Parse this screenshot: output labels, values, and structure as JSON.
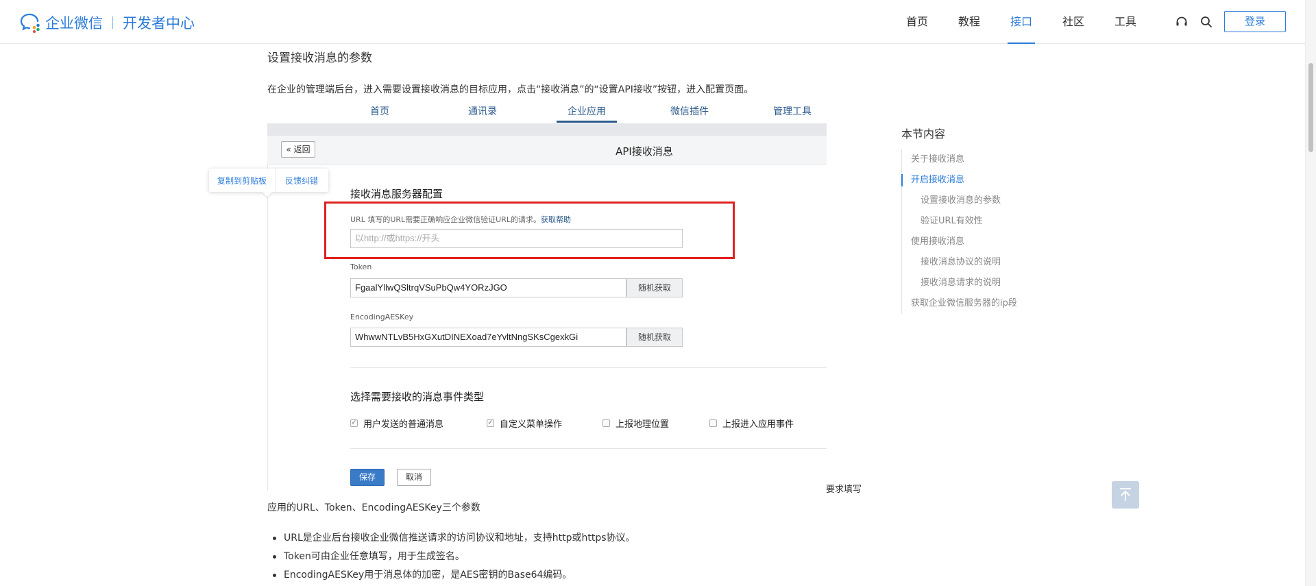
{
  "header": {
    "logo_text": "企业微信",
    "logo_sub": "开发者中心",
    "nav": [
      {
        "label": "首页",
        "active": false
      },
      {
        "label": "教程",
        "active": false
      },
      {
        "label": "接口",
        "active": true
      },
      {
        "label": "社区",
        "active": false
      },
      {
        "label": "工具",
        "active": false
      }
    ],
    "icons": [
      "headset-icon",
      "search-icon"
    ],
    "login_label": "登录"
  },
  "content": {
    "section_title": "设置接收消息的参数",
    "intro": "在企业的管理端后台，进入需要设置接收消息的目标应用，点击“接收消息”的“设置API接收”按钮，进入配置页面。",
    "popover": {
      "copy": "复制到剪贴板",
      "feedback": "反馈纠错"
    },
    "required_note": "要求填写",
    "params_line": "应用的URL、Token、EncodingAESKey三个参数",
    "bullets": [
      "URL是企业后台接收企业微信推送请求的访问协议和地址，支持http或https协议。",
      "Token可由企业任意填写，用于生成签名。",
      "EncodingAESKey用于消息体的加密，是AES密钥的Base64编码。"
    ]
  },
  "screenshot": {
    "tabs": [
      "首页",
      "通讯录",
      "企业应用",
      "微信插件",
      "管理工具"
    ],
    "active_tab": "企业应用",
    "back_label": "« 返回",
    "title": "API接收消息",
    "cfg_title": "接收消息服务器配置",
    "url_label": "URL  填写的URL需要正确响应企业微信验证URL的请求。",
    "url_help": "获取帮助",
    "url_placeholder": "以http://或https://开头",
    "token_label": "Token",
    "token_value": "FgaalYllwQSltrqVSuPbQw4YORzJGO",
    "aes_label": "EncodingAESKey",
    "aes_value": "WhwwNTLvB5HxGXutDINEXoad7eYvltNngSKsCgexkGi",
    "random_label": "随机获取",
    "events_title": "选择需要接收的消息事件类型",
    "events": [
      {
        "label": "用户发送的普通消息",
        "checked": true
      },
      {
        "label": "自定义菜单操作",
        "checked": true
      },
      {
        "label": "上报地理位置",
        "checked": false
      },
      {
        "label": "上报进入应用事件",
        "checked": false
      }
    ],
    "save_label": "保存",
    "cancel_label": "取消"
  },
  "toc": {
    "title": "本节内容",
    "items": [
      {
        "label": "关于接收消息",
        "level": 1,
        "active": false
      },
      {
        "label": "开启接收消息",
        "level": 1,
        "active": true
      },
      {
        "label": "设置接收消息的参数",
        "level": 2,
        "active": false
      },
      {
        "label": "验证URL有效性",
        "level": 2,
        "active": false
      },
      {
        "label": "使用接收消息",
        "level": 1,
        "active": false
      },
      {
        "label": "接收消息协议的说明",
        "level": 2,
        "active": false
      },
      {
        "label": "接收消息请求的说明",
        "level": 2,
        "active": false
      },
      {
        "label": "获取企业微信服务器的ip段",
        "level": 1,
        "active": false
      }
    ]
  },
  "colors": {
    "brand": "#2b7cd9",
    "highlight": "#e02020"
  }
}
